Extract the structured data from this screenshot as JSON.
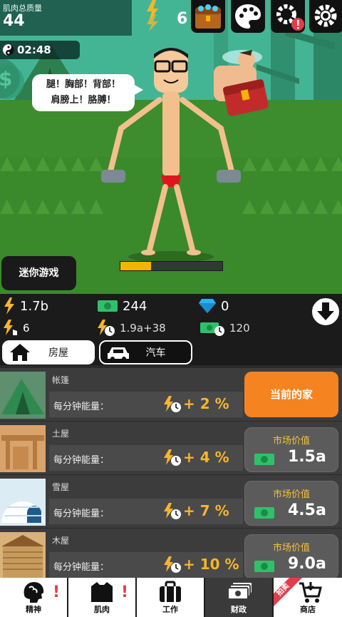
{
  "header": {
    "muscle_label": "肌肉总质量",
    "muscle_value": "44",
    "energy_value": "6",
    "timer": "02:48"
  },
  "speech": {
    "line1": "腿！胸部！背部！",
    "line2": "肩膀上！胳膊！"
  },
  "mini_game_label": "迷你游戏",
  "progress": 0.3,
  "stats": {
    "energy": "1.7b",
    "cash": "244",
    "gems": "0",
    "energy_per_tap": "6",
    "energy_per_time": "1.9a+38",
    "cash_per_time": "120"
  },
  "tabs": {
    "house": "房屋",
    "car": "汽车"
  },
  "energy_label": "每分钟能量：",
  "market_label": "市场价值",
  "current_home_label": "当前的家",
  "houses": [
    {
      "name": "帐篷",
      "bonus": "+ 2 %",
      "current": true,
      "icon": "tent-icon"
    },
    {
      "name": "土屋",
      "bonus": "+ 4 %",
      "price": "1.5a",
      "icon": "mud-house-icon"
    },
    {
      "name": "雪屋",
      "bonus": "+ 7 %",
      "price": "4.5a",
      "icon": "igloo-icon"
    },
    {
      "name": "木屋",
      "bonus": "+ 10 %",
      "price": "9.0a",
      "icon": "wood-cabin-icon"
    }
  ],
  "nav": [
    {
      "label": "精神",
      "icon": "brain-icon",
      "alert": "!"
    },
    {
      "label": "肌肉",
      "icon": "shirt-icon",
      "alert": "!"
    },
    {
      "label": "工作",
      "icon": "briefcase-icon"
    },
    {
      "label": "财政",
      "icon": "cash-stack-icon",
      "active": true
    },
    {
      "label": "商店",
      "icon": "cart-icon",
      "badge": "拍卖"
    }
  ],
  "colors": {
    "sky": "#3fae8c",
    "grass": "#3f8f2f",
    "accent_orange": "#f5831f",
    "energy_yellow": "#f7b52a",
    "alert_red": "#e33d4c"
  }
}
